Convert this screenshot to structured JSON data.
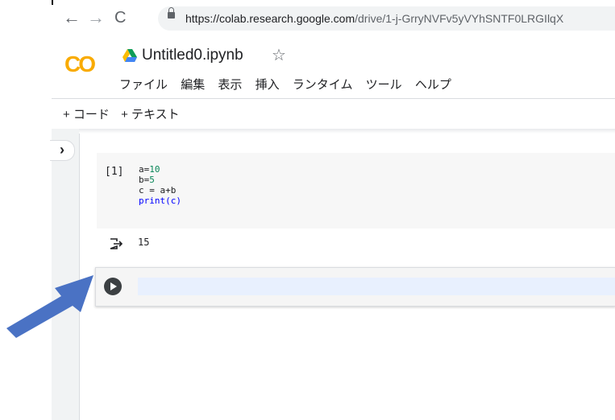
{
  "browser": {
    "back_icon": "←",
    "forward_icon": "→",
    "reload_icon": "C",
    "url_host": "https://colab.research.google.com",
    "url_path": "/drive/1-j-GrryNVFv5yVYhSNTF0LRGIlqX"
  },
  "header": {
    "logo_text": "CO",
    "notebook_title": "Untitled0.ipynb",
    "star_icon": "☆"
  },
  "menu": [
    "ファイル",
    "編集",
    "表示",
    "挿入",
    "ランタイム",
    "ツール",
    "ヘルプ"
  ],
  "toolbar": {
    "add_code": "+ コード",
    "add_text": "+ テキスト"
  },
  "sidebar": {
    "toggle_icon": "›"
  },
  "cell": {
    "exec_count": "[1]",
    "code_lines": [
      "a=10",
      "b=5",
      "c = a+b",
      "print(c)"
    ],
    "output": "15"
  },
  "colors": {
    "logo_yellow": "#f9ab00",
    "logo_orange": "#e8710a",
    "arrow_blue": "#4a72c4",
    "input_highlight": "#e8f0fe"
  }
}
